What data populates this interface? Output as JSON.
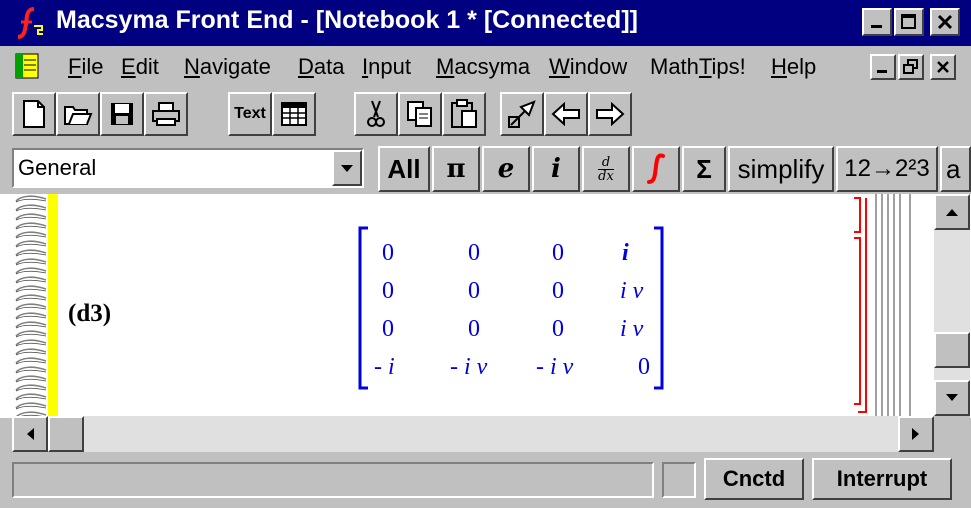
{
  "window": {
    "title": "Macsyma Front End - [Notebook 1 * [Connected]]"
  },
  "menu": {
    "items": [
      {
        "label": "File",
        "ul": "F"
      },
      {
        "label": "Edit",
        "ul": "E"
      },
      {
        "label": "Navigate",
        "ul": "N"
      },
      {
        "label": "Data",
        "ul": "D"
      },
      {
        "label": "Input",
        "ul": "I"
      },
      {
        "label": "Macsyma",
        "ul": "M"
      },
      {
        "label": "Window",
        "ul": "W"
      },
      {
        "label": "MathTips!",
        "ul": "T"
      },
      {
        "label": "Help",
        "ul": "H"
      }
    ]
  },
  "toolbar": {
    "text_button": "Text"
  },
  "palette": {
    "mode_value": "General",
    "buttons": {
      "all": "All",
      "pi": "π",
      "e": "e",
      "i": "i",
      "deriv_num": "d",
      "deriv_den": "dx",
      "sigma": "Σ",
      "simplify": "simplify",
      "expand": "12→2²3",
      "more": "a"
    }
  },
  "document": {
    "output_label": "(d3)",
    "matrix": [
      [
        "0",
        "0",
        "0",
        "i"
      ],
      [
        "0",
        "0",
        "0",
        "i v"
      ],
      [
        "0",
        "0",
        "0",
        "i v"
      ],
      [
        "- i",
        "- i v",
        "- i v",
        "0"
      ]
    ]
  },
  "status": {
    "connected_label": "Cnctd",
    "interrupt_label": "Interrupt"
  },
  "colors": {
    "titlebar": "#000080",
    "matrix_text": "#0000e0",
    "cell_bracket": "#ff0000",
    "notebook_margin": "#ffff00"
  }
}
